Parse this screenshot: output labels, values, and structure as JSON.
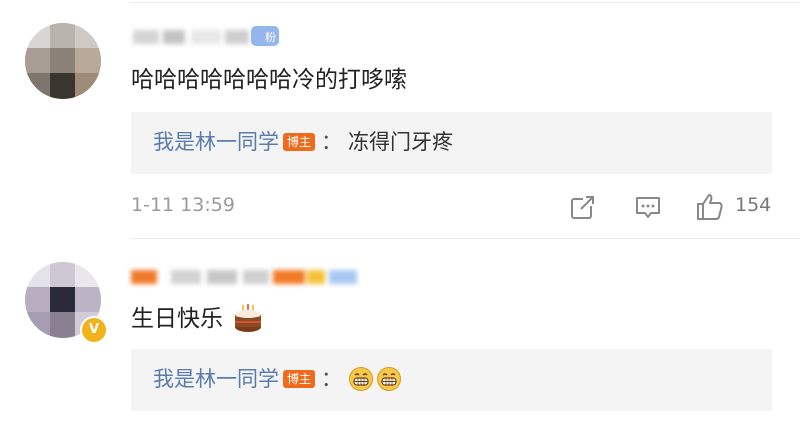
{
  "comments": [
    {
      "author_redacted": true,
      "fan_badge_text": "粉",
      "text": "哈哈哈哈哈哈哈冷的打哆嗦",
      "reply": {
        "author": "我是林一同学",
        "tag": "博主",
        "colon": "：",
        "text": "冻得门牙疼"
      },
      "time": "1-11 13:59",
      "likes": "154",
      "icons": [
        "share-icon",
        "comment-icon",
        "like-icon"
      ]
    },
    {
      "author_redacted": true,
      "text": "生日快乐",
      "text_emoji": "birthday-cake-emoji",
      "verified_badge": "V",
      "reply": {
        "author": "我是林一同学",
        "tag": "博主",
        "colon": "：",
        "emojis": [
          "grin-emoji",
          "grin-emoji"
        ]
      }
    }
  ],
  "colors": {
    "link_blue": "#5a7bb0",
    "host_tag_orange": "#f06a1b",
    "reply_bg": "#f4f4f4",
    "meta_gray": "#9a9a9a",
    "vip_gold": "#f2b21b"
  }
}
